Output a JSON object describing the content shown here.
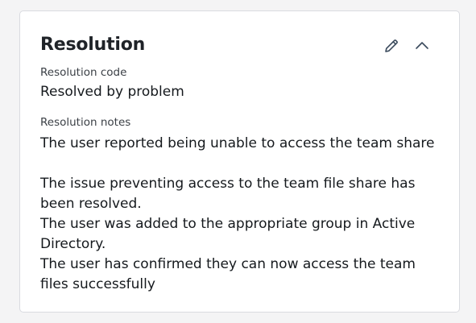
{
  "card": {
    "title": "Resolution",
    "edit_icon": "pencil-icon",
    "collapse_icon": "chevron-up-icon"
  },
  "fields": {
    "code_label": "Resolution code",
    "code_value": "Resolved by problem",
    "notes_label": "Resolution notes",
    "notes_value": "The user reported being unable to access the team share\n\nThe issue preventing access to the team file share has been resolved.\nThe user was added to the appropriate group in Active Directory.\nThe user has confirmed they can now access the team files successfully"
  },
  "colors": {
    "background": "#f4f4f5",
    "card_border": "#d9dbe0",
    "text": "#1f2328",
    "icon": "#3a4a5c"
  }
}
